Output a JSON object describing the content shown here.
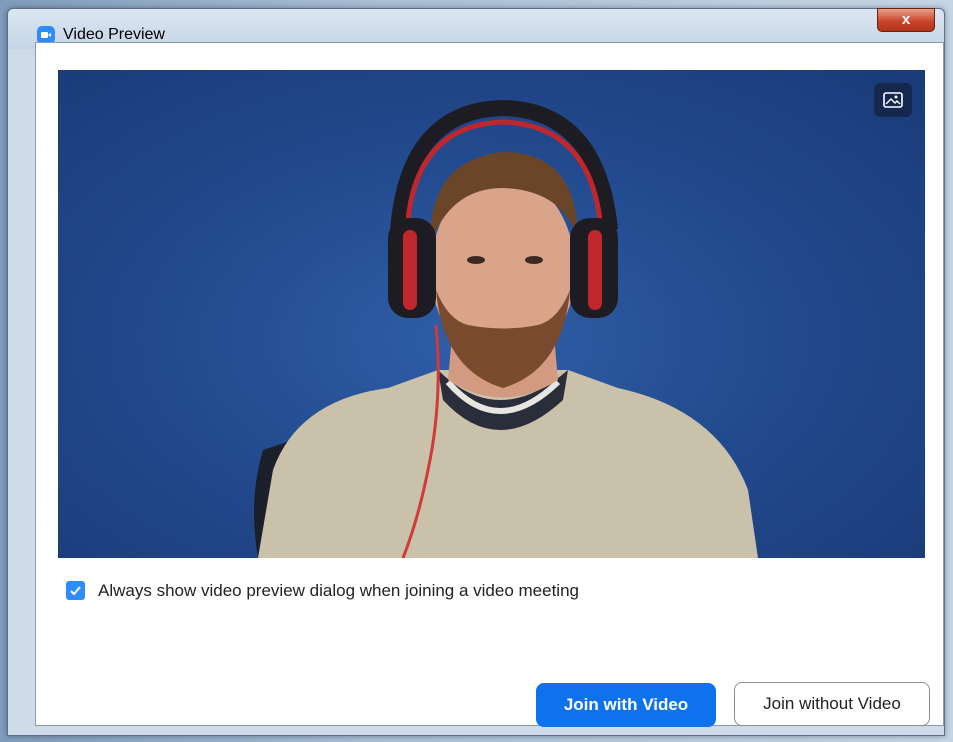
{
  "window": {
    "title": "Video Preview",
    "close_label": "x",
    "app_icon": "zoom-video-icon"
  },
  "video": {
    "background_button_icon": "image-icon"
  },
  "options": {
    "always_show_preview_label": "Always show video preview dialog when joining a video meeting",
    "always_show_preview_checked": true
  },
  "actions": {
    "join_with_video_label": "Join with Video",
    "join_without_video_label": "Join without Video"
  },
  "colors": {
    "accent": "#0e72ed",
    "checkbox": "#2d8cff"
  }
}
